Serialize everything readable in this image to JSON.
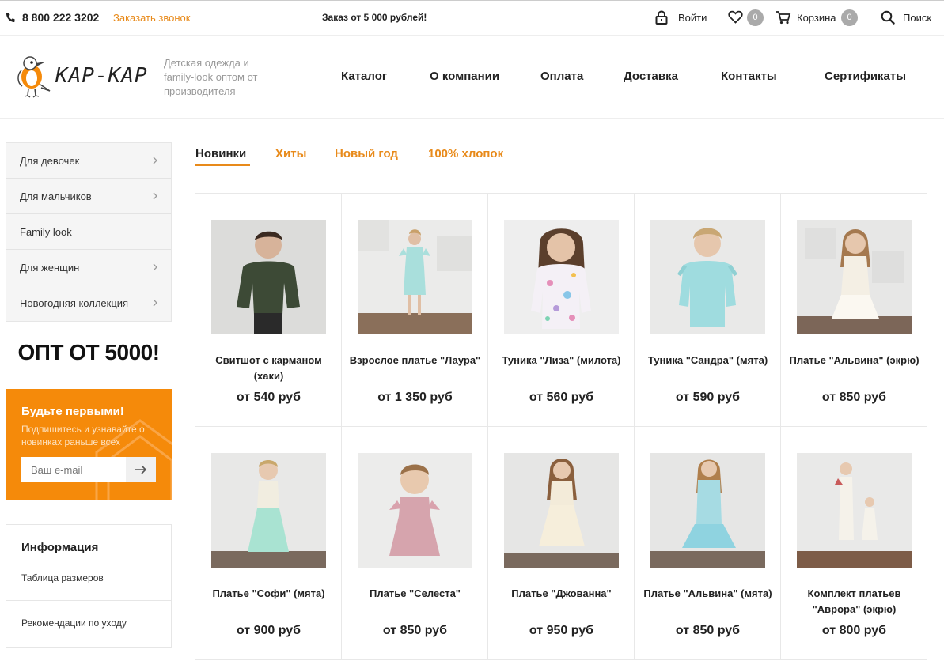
{
  "topbar": {
    "phone": "8 800 222 3202",
    "callback": "Заказать звонок",
    "order_note": "Заказ от 5 000 рублей!",
    "login": "Войти",
    "favorites_count": "0",
    "cart": "Корзина",
    "cart_count": "0",
    "search": "Поиск"
  },
  "header": {
    "logo_text": "КАР-КАР",
    "tagline": "Детская одежда и family-look оптом от производителя",
    "nav": [
      "Каталог",
      "О компании",
      "Оплата",
      "Доставка",
      "Контакты",
      "Сертификаты"
    ]
  },
  "sidebar": {
    "menu": [
      {
        "label": "Для девочек",
        "has_arrow": true
      },
      {
        "label": "Для мальчиков",
        "has_arrow": true
      },
      {
        "label": "Family look",
        "has_arrow": false
      },
      {
        "label": "Для женщин",
        "has_arrow": true
      },
      {
        "label": "Новогодняя коллекция",
        "has_arrow": true
      }
    ],
    "promo": "ОПТ ОТ 5000!",
    "subscribe": {
      "title": "Будьте первыми!",
      "text": "Подпишитесь и узнавайте о новинках раньше всех",
      "placeholder": "Ваш e-mail"
    },
    "info": {
      "title": "Информация",
      "links": [
        "Таблица размеров",
        "Рекомендации по уходу"
      ]
    }
  },
  "tabs": [
    "Новинки",
    "Хиты",
    "Новый год",
    "100% хлопок"
  ],
  "products": [
    {
      "name": "Свитшот с карманом (хаки)",
      "price": "от 540 руб"
    },
    {
      "name": "Взрослое платье \"Лаура\"",
      "price": "от 1 350 руб"
    },
    {
      "name": "Туника \"Лиза\" (милота)",
      "price": "от 560 руб"
    },
    {
      "name": "Туника \"Сандра\" (мята)",
      "price": "от 590 руб"
    },
    {
      "name": "Платье \"Альвина\" (экрю)",
      "price": "от 850 руб"
    },
    {
      "name": "Платье \"Софи\" (мята)",
      "price": "от 900 руб"
    },
    {
      "name": "Платье \"Селеста\"",
      "price": "от 850 руб"
    },
    {
      "name": "Платье \"Джованна\"",
      "price": "от 950 руб"
    },
    {
      "name": "Платье \"Альвина\" (мята)",
      "price": "от 850 руб"
    },
    {
      "name": "Комплект платьев \"Аврора\" (экрю)",
      "price": "от 800 руб"
    }
  ],
  "colors": {
    "accent": "#e88a1a",
    "subscribe_bg": "#f58a0a"
  }
}
